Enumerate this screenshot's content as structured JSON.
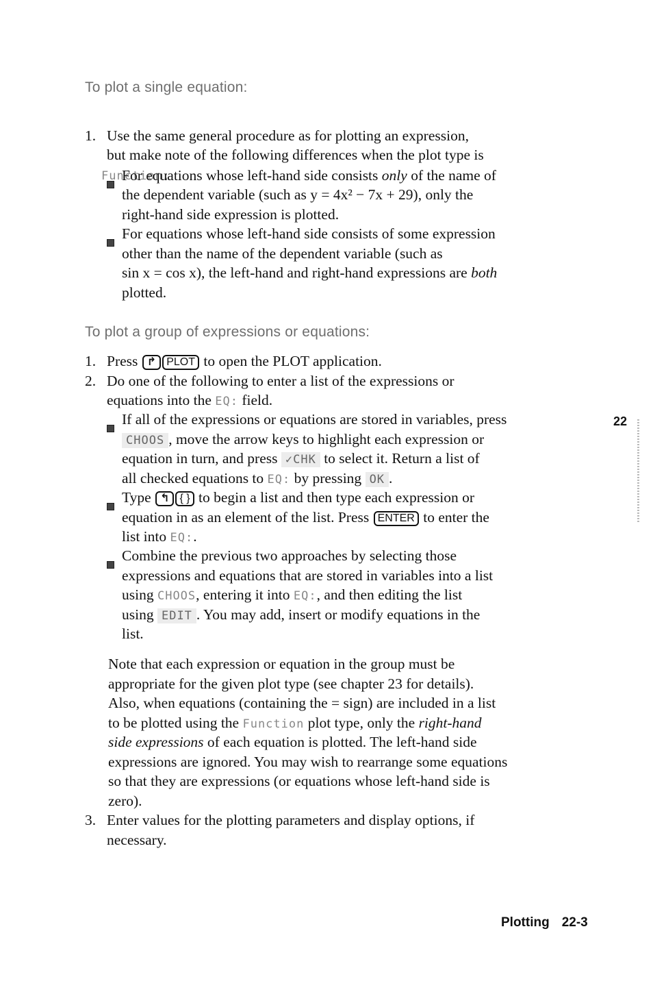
{
  "section1": {
    "heading": "To plot a single equation:",
    "step1_num": "1.",
    "step1_lines": [
      "Use the same general procedure as for plotting an expression,",
      "but make note of the following differences when the plot type is"
    ],
    "plot_type_code": "Function",
    "plot_type_suffix": ":",
    "bullet1": {
      "a": "For equations whose left-hand side consists ",
      "a_em": "only",
      "a_rest": " of the name of",
      "b": "the dependent variable (such as y = 4x² − 7x + 29), only the",
      "c": "right-hand side expression is plotted."
    },
    "bullet2": {
      "a": "For equations whose left-hand side consists of some expression",
      "b": "other than the name of the dependent variable (such as",
      "c": "sin x = cos x), the left-hand and right-hand expressions are ",
      "c_em": "both",
      "d": "plotted."
    }
  },
  "section2": {
    "heading": "To plot a group of expressions or equations:",
    "step1": {
      "num": "1.",
      "pre": "Press ",
      "key_shift": "↱",
      "key": "PLOT",
      "post": " to open the PLOT application."
    },
    "step2": {
      "num": "2.",
      "a": "Do one of the following to enter a list of the expressions or",
      "b_pre": "equations into the ",
      "b_code": "EQ:",
      "b_post": " field."
    },
    "bullet1": {
      "a": "If all of the expressions or equations are stored in variables, press",
      "b_key": "CHOOS",
      "b": ", move the arrow keys to highlight each expression or",
      "c_pre": "equation in turn, and press ",
      "c_key": "✓CHK",
      "c_post": " to select it. Return a list of",
      "d_pre": "all checked equations to ",
      "d_code": "EQ:",
      "d_mid": " by pressing ",
      "d_key": "OK",
      "d_post": "."
    },
    "bullet2": {
      "a_pre": "Type ",
      "a_key_shift": "↰",
      "a_key": "{ }",
      "a_post": " to begin a list and then type each expression or",
      "b_pre": "equation in as an element of the list. Press ",
      "b_key": "ENTER",
      "b_post": " to enter the",
      "c_pre": "list into ",
      "c_code": "EQ:",
      "c_post": "."
    },
    "bullet3": {
      "a": "Combine the previous two approaches by selecting those",
      "b": "expressions and equations that are stored in variables into a list",
      "c_pre": "using ",
      "c_key": "CHOOS",
      "c_mid": ", entering it into ",
      "c_code": "EQ:",
      "c_post": ", and then editing the list",
      "d_pre": "using ",
      "d_key": "EDIT",
      "d_post": ". You may add, insert or modify equations in the",
      "e": "list."
    },
    "note": {
      "l1": "Note that each expression or equation in the group must be",
      "l2": "appropriate for the given plot type (see chapter 23 for details).",
      "l3": "Also, when equations (containing the = sign) are included in a list",
      "l4_pre": "to be plotted using the ",
      "l4_code": "Function",
      "l4_mid": " plot type, only the ",
      "l4_em": "right-hand",
      "l5_em": "side expressions",
      "l5_post": " of each equation is plotted. The left-hand side",
      "l6": "expressions are ignored. You may wish to rearrange some equations",
      "l7": "so that they are expressions (or equations whose left-hand side is",
      "l8": "zero)."
    },
    "step3": {
      "num": "3.",
      "a": "Enter values for the plotting parameters and display options, if",
      "b": "necessary."
    }
  },
  "chapter_tab": "22",
  "footer": {
    "section": "Plotting",
    "page": "22-3"
  }
}
